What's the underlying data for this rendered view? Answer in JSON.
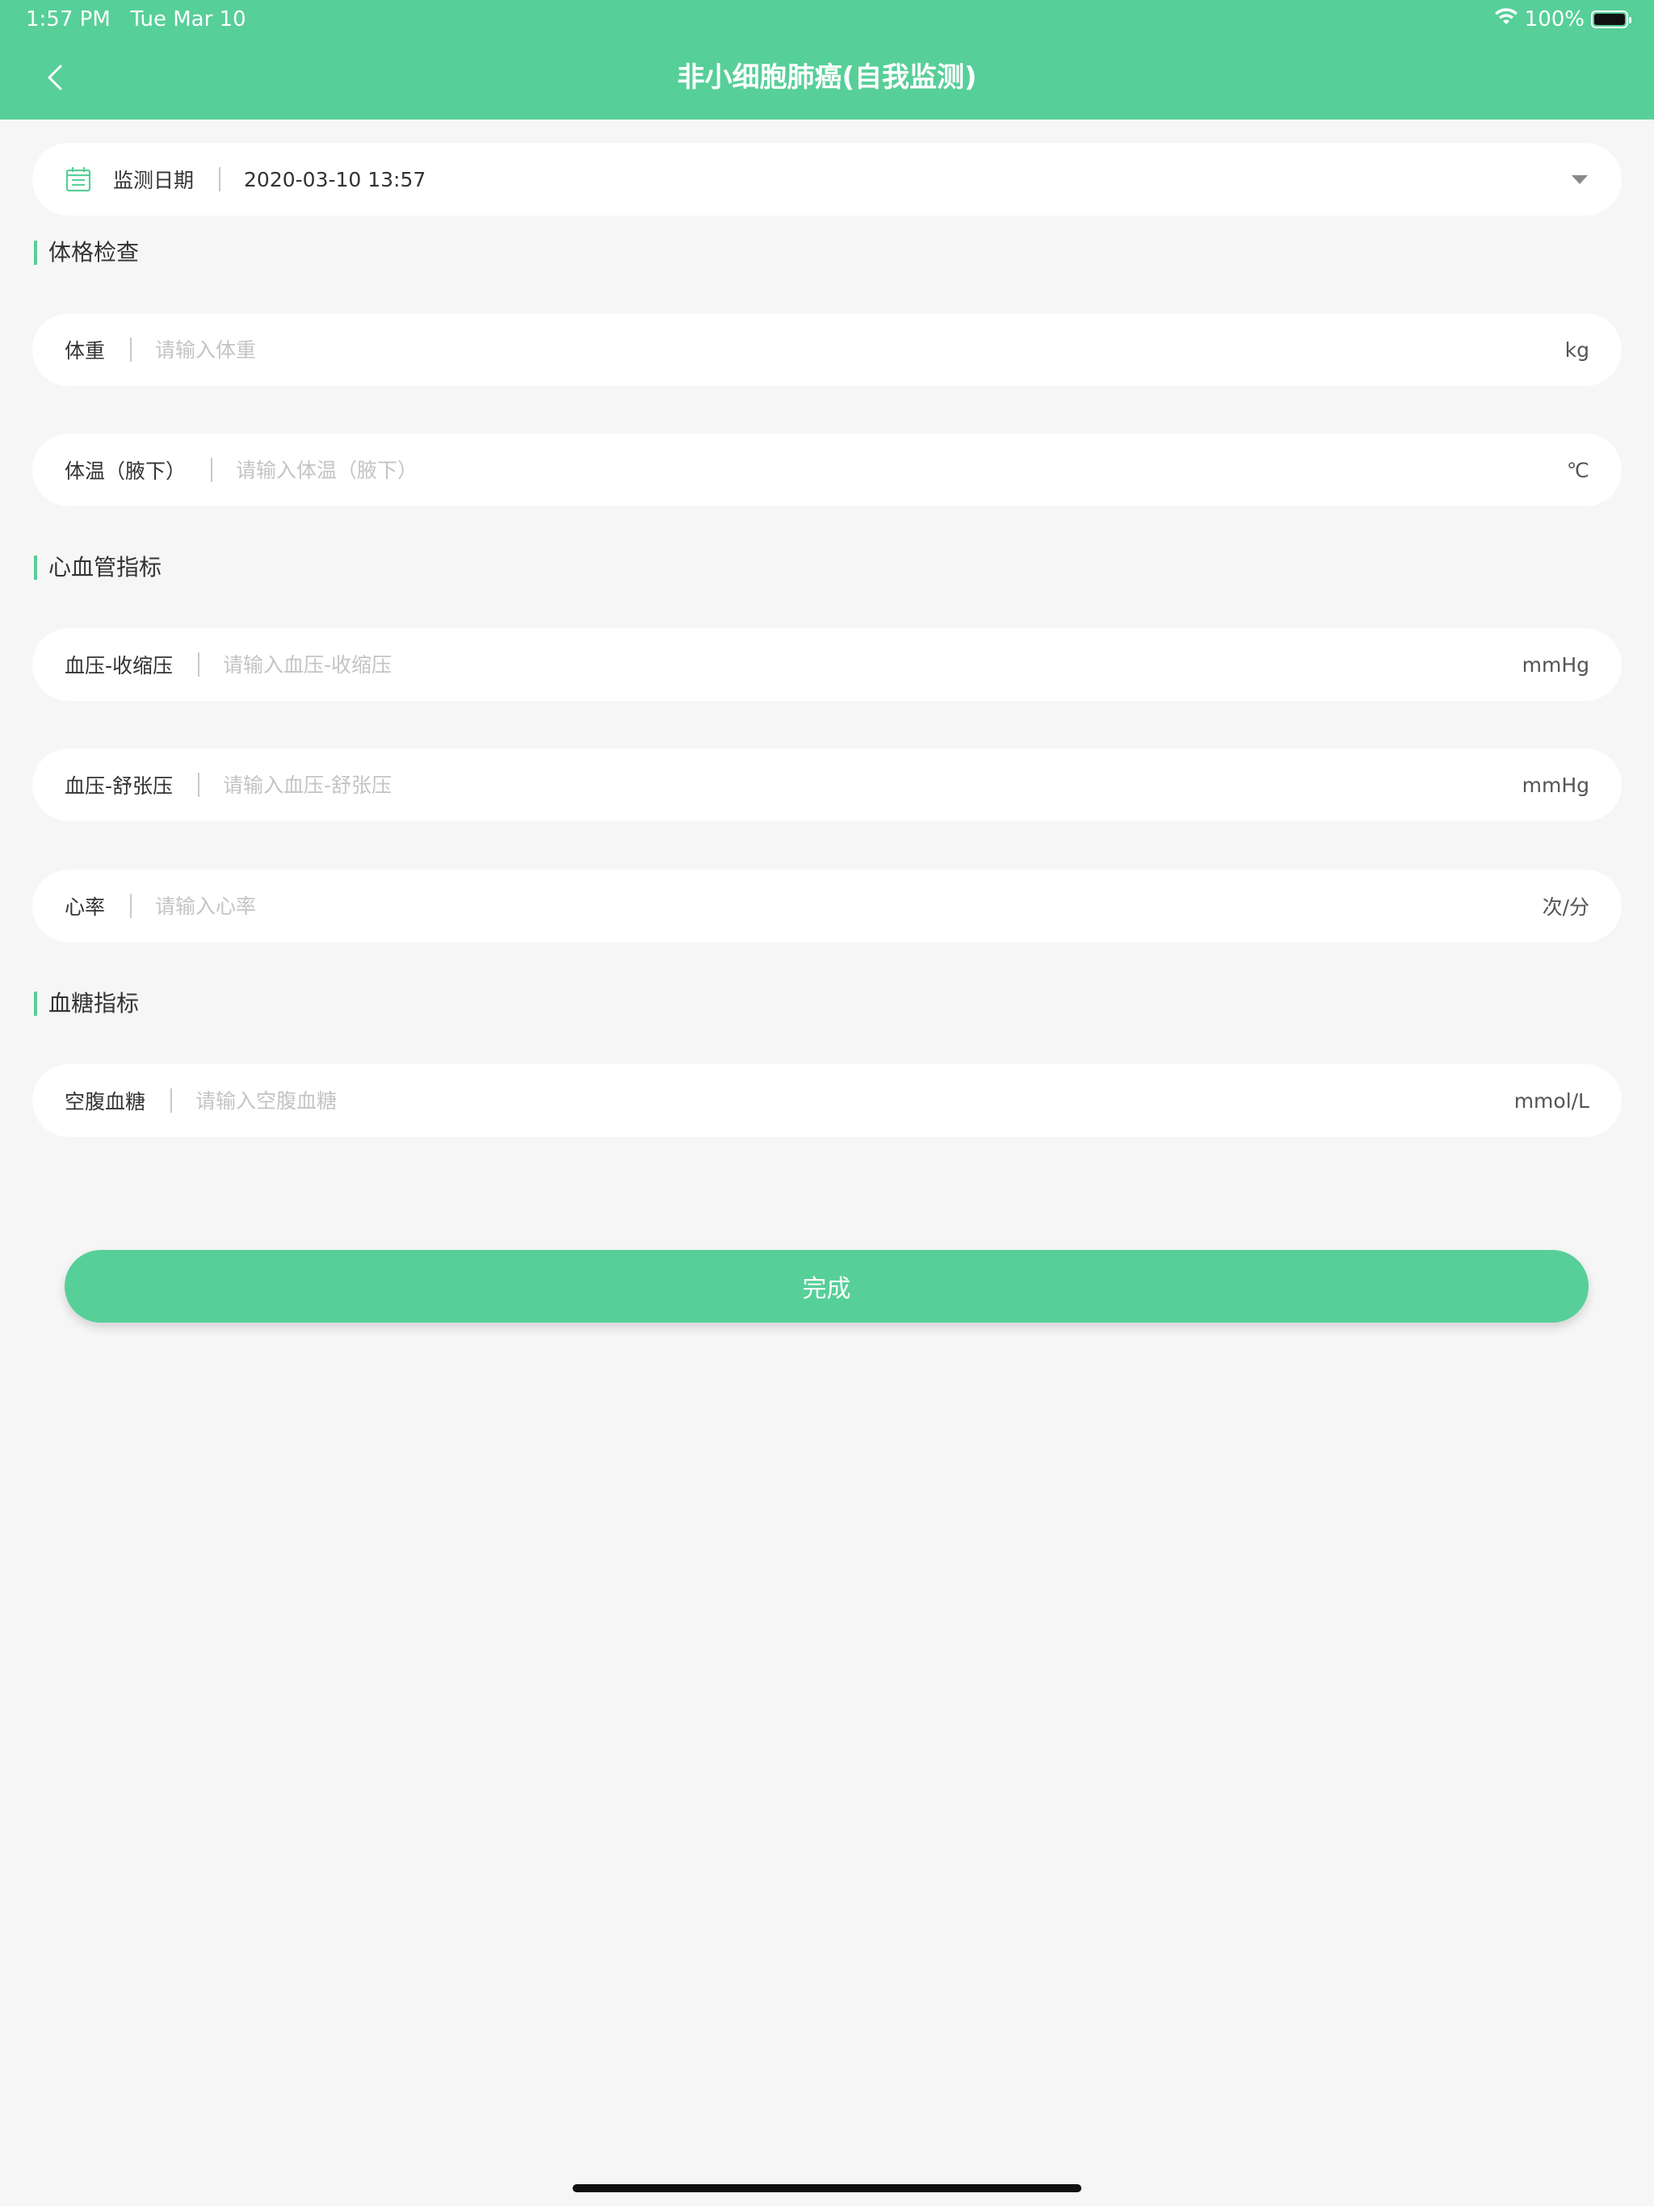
{
  "status_bar": {
    "time": "1:57 PM   Tue Mar 10",
    "battery": "100%",
    "battery_level": 1.0
  },
  "header": {
    "title": "非小细胞肺癌(自我监测)",
    "background": "#57cf98"
  },
  "date_row": {
    "label": "监测日期",
    "value": "2020-03-10 13:57",
    "icon": "calendar-icon",
    "dropdown_icon": "triangle-down-icon"
  },
  "sections": {
    "physical": {
      "title": "体格检查"
    },
    "cardio": {
      "title": "心血管指标"
    },
    "glucose": {
      "title": "血糖指标"
    }
  },
  "fields": {
    "weight": {
      "label": "体重",
      "placeholder": "请输入体重",
      "value": "",
      "unit": "kg"
    },
    "temperature": {
      "label": "体温（腋下）",
      "placeholder": "请输入体温（腋下）",
      "value": "",
      "unit": "℃"
    },
    "systolic": {
      "label": "血压-收缩压",
      "placeholder": "请输入血压-收缩压",
      "value": "",
      "unit": "mmHg"
    },
    "diastolic": {
      "label": "血压-舒张压",
      "placeholder": "请输入血压-舒张压",
      "value": "",
      "unit": "mmHg"
    },
    "heart_rate": {
      "label": "心率",
      "placeholder": "请输入心率",
      "value": "",
      "unit": "次/分"
    },
    "fasting_glucose": {
      "label": "空腹血糖",
      "placeholder": "请输入空腹血糖",
      "value": "",
      "unit": "mmol/L"
    }
  },
  "done_button": {
    "label": "完成"
  },
  "colors": {
    "accent": "#57cf98",
    "background": "#f6f6f6",
    "card": "#ffffff",
    "placeholder": "#c4c4c4"
  }
}
